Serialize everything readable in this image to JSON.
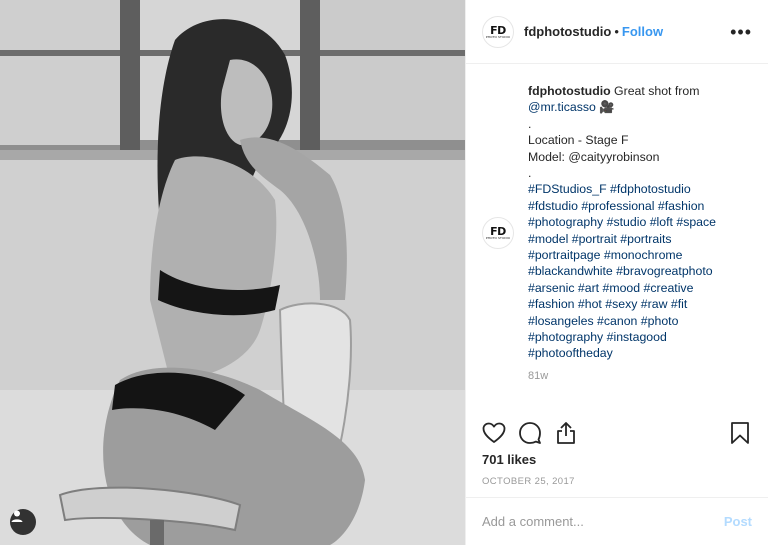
{
  "post": {
    "username": "fdphotostudio",
    "follow_label": "Follow",
    "separator": "•",
    "more_label": "•••",
    "logo": {
      "main": "FD",
      "sub": "PHOTO STUDIO"
    }
  },
  "caption": {
    "username": "fdphotostudio",
    "lines": [
      {
        "text": " Great shot from"
      },
      {
        "text": "@mr.ticasso 🎥"
      },
      {
        "text": "."
      },
      {
        "text": "Location - Stage F"
      },
      {
        "text": "Model: @caityyrobinson"
      },
      {
        "text": "."
      },
      {
        "text": "#FDStudios_F #fdphotostudio"
      },
      {
        "text": "#fdstudio #professional #fashion"
      },
      {
        "text": "#photography #studio #loft #space"
      },
      {
        "text": "#model #portrait #portraits"
      },
      {
        "text": "#portraitpage #monochrome"
      },
      {
        "text": "#blackandwhite #bravogreatphoto"
      },
      {
        "text": "#arsenic #art #mood #creative"
      },
      {
        "text": "#fashion #hot #sexy #raw #fit"
      },
      {
        "text": "#losangeles #canon #photo"
      },
      {
        "text": "#photography #instagood"
      },
      {
        "text": "#photooftheday"
      }
    ],
    "time": "81w"
  },
  "stats": {
    "likes": "701 likes",
    "date": "OCTOBER 25, 2017"
  },
  "comment_box": {
    "placeholder": "Add a comment...",
    "post_label": "Post"
  },
  "icons": {
    "like": "heart-icon",
    "comment": "comment-icon",
    "share": "share-icon",
    "save": "bookmark-icon",
    "user_tag": "user-tag-icon"
  },
  "colors": {
    "link": "#3897f0",
    "hashtag": "#003569",
    "muted": "#999999",
    "post_disabled": "#b3dbff"
  }
}
